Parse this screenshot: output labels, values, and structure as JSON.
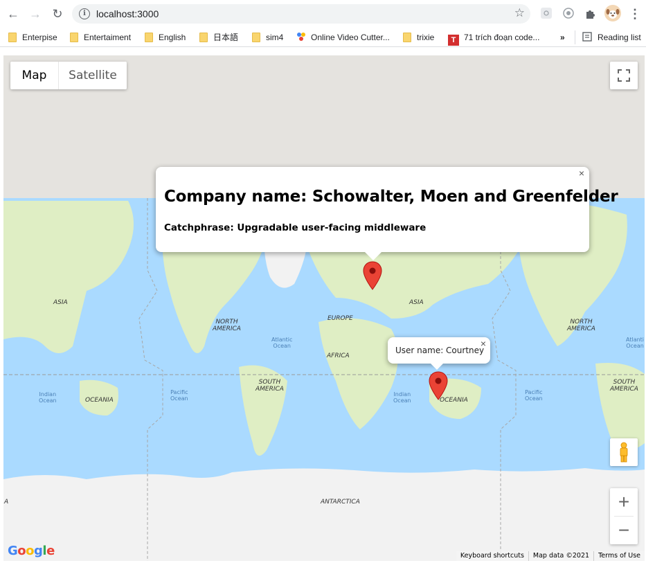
{
  "browser": {
    "url": "localhost:3000",
    "bookmarks": [
      "Enterpise",
      "Entertaiment",
      "English",
      "日本語",
      "sim4",
      "Online Video Cutter...",
      "trixie",
      "71 trích đoạn code...",
      "»",
      "Reading list"
    ]
  },
  "map": {
    "map_type_options": [
      "Map",
      "Satellite"
    ],
    "selected_type": "Map",
    "labels": {
      "asia_left": "ASIA",
      "north_america_left": "NORTH\nAMERICA",
      "europe": "EUROPE",
      "asia": "ASIA",
      "north_america_right": "NORTH\nAMERICA",
      "africa": "AFRICA",
      "atlantic_mid": "Atlantic\nOcean",
      "atlantic_right": "Atlanti\nOcean",
      "south_america_left": "SOUTH\nAMERICA",
      "south_america_right": "SOUTH\nAMERICA",
      "indian_left": "Indian\nOcean",
      "indian_mid": "Indian\nOcean",
      "oceania_left": "OCEANIA",
      "oceania_mid": "OCEANIA",
      "pacific_left": "Pacific\nOcean",
      "pacific_right": "Pacific\nOcean",
      "antarctica": "ANTARCTICA",
      "a_edge": "A"
    },
    "info_window_main": {
      "title": "Company name: Schowalter, Moen and Greenfelder",
      "subtitle": "Catchphrase: Upgradable user-facing middleware"
    },
    "info_window_small": {
      "text": "User name: Courtney"
    },
    "close_symbol": "×",
    "zoom_in": "+",
    "zoom_out": "−",
    "attribution": [
      "Keyboard shortcuts",
      "Map data ©2021",
      "Terms of Use"
    ],
    "logo_text": "Google"
  },
  "colors": {
    "water": "#aadaff",
    "land": "#dfeec4",
    "ice": "#f2f2f2",
    "marker": "#ea4335"
  }
}
